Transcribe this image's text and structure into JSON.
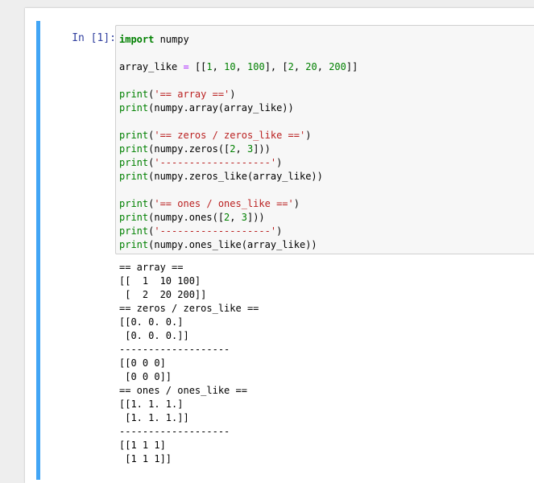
{
  "cell": {
    "prompt": "In [1]:",
    "code_lines": [
      [
        {
          "t": "import",
          "c": "kw"
        },
        {
          "t": " numpy",
          "c": ""
        }
      ],
      [],
      [
        {
          "t": "array_like ",
          "c": ""
        },
        {
          "t": "=",
          "c": "op"
        },
        {
          "t": " [[",
          "c": ""
        },
        {
          "t": "1",
          "c": "num"
        },
        {
          "t": ", ",
          "c": ""
        },
        {
          "t": "10",
          "c": "num"
        },
        {
          "t": ", ",
          "c": ""
        },
        {
          "t": "100",
          "c": "num"
        },
        {
          "t": "], [",
          "c": ""
        },
        {
          "t": "2",
          "c": "num"
        },
        {
          "t": ", ",
          "c": ""
        },
        {
          "t": "20",
          "c": "num"
        },
        {
          "t": ", ",
          "c": ""
        },
        {
          "t": "200",
          "c": "num"
        },
        {
          "t": "]]",
          "c": ""
        }
      ],
      [],
      [
        {
          "t": "print",
          "c": "bi"
        },
        {
          "t": "(",
          "c": ""
        },
        {
          "t": "'== array =='",
          "c": "str"
        },
        {
          "t": ")",
          "c": ""
        }
      ],
      [
        {
          "t": "print",
          "c": "bi"
        },
        {
          "t": "(numpy.array(array_like))",
          "c": ""
        }
      ],
      [],
      [
        {
          "t": "print",
          "c": "bi"
        },
        {
          "t": "(",
          "c": ""
        },
        {
          "t": "'== zeros / zeros_like =='",
          "c": "str"
        },
        {
          "t": ")",
          "c": ""
        }
      ],
      [
        {
          "t": "print",
          "c": "bi"
        },
        {
          "t": "(numpy.zeros([",
          "c": ""
        },
        {
          "t": "2",
          "c": "num"
        },
        {
          "t": ", ",
          "c": ""
        },
        {
          "t": "3",
          "c": "num"
        },
        {
          "t": "]))",
          "c": ""
        }
      ],
      [
        {
          "t": "print",
          "c": "bi"
        },
        {
          "t": "(",
          "c": ""
        },
        {
          "t": "'-------------------'",
          "c": "str"
        },
        {
          "t": ")",
          "c": ""
        }
      ],
      [
        {
          "t": "print",
          "c": "bi"
        },
        {
          "t": "(numpy.zeros_like(array_like))",
          "c": ""
        }
      ],
      [],
      [
        {
          "t": "print",
          "c": "bi"
        },
        {
          "t": "(",
          "c": ""
        },
        {
          "t": "'== ones / ones_like =='",
          "c": "str"
        },
        {
          "t": ")",
          "c": ""
        }
      ],
      [
        {
          "t": "print",
          "c": "bi"
        },
        {
          "t": "(numpy.ones([",
          "c": ""
        },
        {
          "t": "2",
          "c": "num"
        },
        {
          "t": ", ",
          "c": ""
        },
        {
          "t": "3",
          "c": "num"
        },
        {
          "t": "]))",
          "c": ""
        }
      ],
      [
        {
          "t": "print",
          "c": "bi"
        },
        {
          "t": "(",
          "c": ""
        },
        {
          "t": "'-------------------'",
          "c": "str"
        },
        {
          "t": ")",
          "c": ""
        }
      ],
      [
        {
          "t": "print",
          "c": "bi"
        },
        {
          "t": "(numpy.ones_like(array_like))",
          "c": ""
        }
      ]
    ],
    "output_lines": [
      "== array ==",
      "[[  1  10 100]",
      " [  2  20 200]]",
      "== zeros / zeros_like ==",
      "[[0. 0. 0.]",
      " [0. 0. 0.]]",
      "-------------------",
      "[[0 0 0]",
      " [0 0 0]]",
      "== ones / ones_like ==",
      "[[1. 1. 1.]",
      " [1. 1. 1.]]",
      "-------------------",
      "[[1 1 1]",
      " [1 1 1]]"
    ]
  },
  "colors": {
    "cell_border": "#42a5f5",
    "prompt": "#303f9f",
    "keyword": "#008000",
    "string": "#ba2121",
    "operator": "#aa22ff"
  }
}
